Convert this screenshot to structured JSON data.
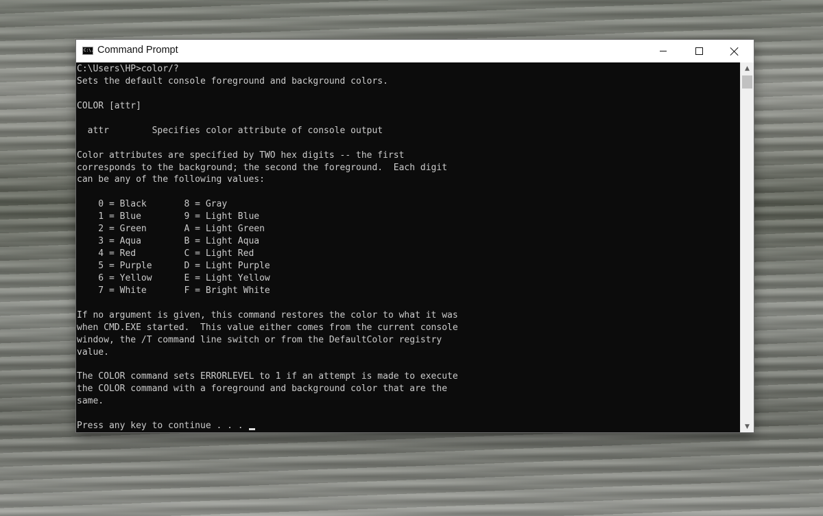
{
  "window": {
    "title": "Command Prompt",
    "app_icon_text": "C:\\."
  },
  "controls": {
    "minimize": "minimize",
    "maximize": "maximize",
    "close": "close"
  },
  "console": {
    "lines": [
      "C:\\Users\\HP>color/?",
      "Sets the default console foreground and background colors.",
      "",
      "COLOR [attr]",
      "",
      "  attr        Specifies color attribute of console output",
      "",
      "Color attributes are specified by TWO hex digits -- the first",
      "corresponds to the background; the second the foreground.  Each digit",
      "can be any of the following values:",
      "",
      "    0 = Black       8 = Gray",
      "    1 = Blue        9 = Light Blue",
      "    2 = Green       A = Light Green",
      "    3 = Aqua        B = Light Aqua",
      "    4 = Red         C = Light Red",
      "    5 = Purple      D = Light Purple",
      "    6 = Yellow      E = Light Yellow",
      "    7 = White       F = Bright White",
      "",
      "If no argument is given, this command restores the color to what it was",
      "when CMD.EXE started.  This value either comes from the current console",
      "window, the /T command line switch or from the DefaultColor registry",
      "value.",
      "",
      "The COLOR command sets ERRORLEVEL to 1 if an attempt is made to execute",
      "the COLOR command with a foreground and background color that are the",
      "same.",
      "",
      "Press any key to continue . . . "
    ],
    "text_color": "#cccccc",
    "background_color": "#0c0c0c"
  },
  "scrollbar": {
    "up_arrow": "▲",
    "down_arrow": "▼"
  }
}
